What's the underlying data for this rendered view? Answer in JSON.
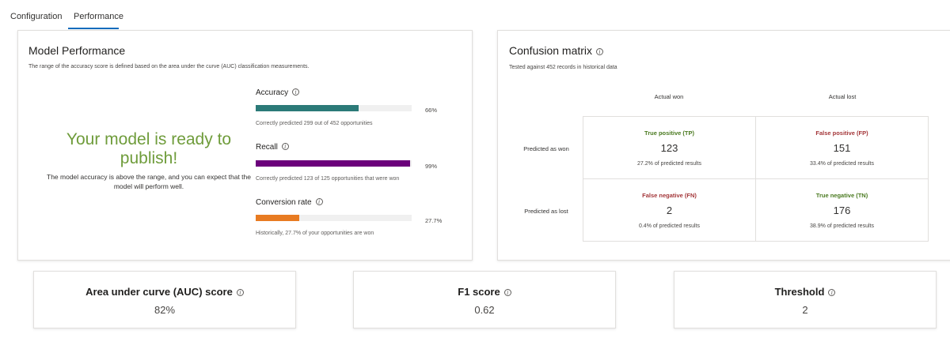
{
  "tabs": [
    {
      "label": "Configuration"
    },
    {
      "label": "Performance",
      "selected": true
    }
  ],
  "model_performance": {
    "title": "Model Performance",
    "subtitle": "The range of the accuracy score is defined based on the area under the curve (AUC) classification measurements.",
    "status_title": "Your model is ready to publish!",
    "status_description": "The model accuracy is above the range, and you can expect that the model will perform well.",
    "status_color": "#6f9c3b",
    "metrics": [
      {
        "label": "Accuracy",
        "value_text": "66%",
        "value": 66,
        "note": "Correctly predicted 299 out of 452 opportunities",
        "color": "#2b7a78"
      },
      {
        "label": "Recall",
        "value_text": "99%",
        "value": 99,
        "note": "Correctly predicted 123 of 125 opportunities that were won",
        "color": "#6b007b"
      },
      {
        "label": "Conversion rate",
        "value_text": "27.7%",
        "value": 27.7,
        "note": "Historically, 27.7% of your opportunities are won",
        "color": "#e87b22"
      }
    ]
  },
  "confusion_matrix": {
    "title": "Confusion matrix",
    "subtitle": "Tested against 452 records in historical data",
    "columns": [
      "Actual won",
      "Actual lost"
    ],
    "rows": [
      "Predicted as won",
      "Predicted as lost"
    ],
    "cells": [
      {
        "kind": "True positive (TP)",
        "count": "123",
        "percent": "27.2% of predicted results"
      },
      {
        "kind": "False positive (FP)",
        "count": "151",
        "percent": "33.4% of predicted results"
      },
      {
        "kind": "False negative (FN)",
        "count": "2",
        "percent": "0.4% of predicted results"
      },
      {
        "kind": "True negative (TN)",
        "count": "176",
        "percent": "38.9% of predicted results"
      }
    ]
  },
  "scores": [
    {
      "label": "Area under curve (AUC) score",
      "value": "82%"
    },
    {
      "label": "F1 score",
      "value": "0.62"
    },
    {
      "label": "Threshold",
      "value": "2"
    }
  ],
  "info_icon": "info-circle-icon"
}
